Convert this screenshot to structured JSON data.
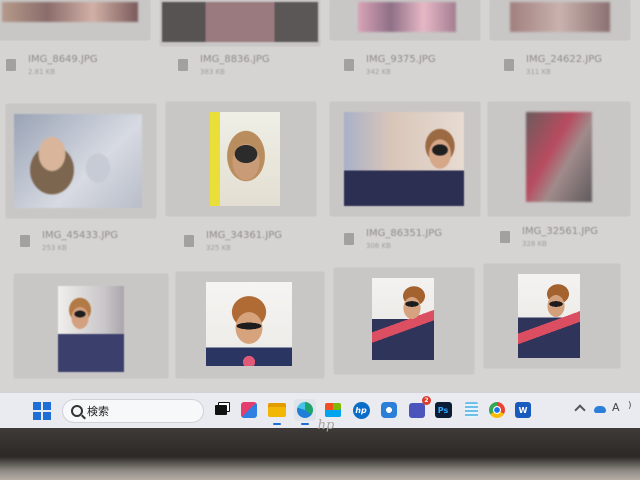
{
  "gallery": {
    "rows": [
      {
        "items": [
          {
            "name": "IMG_8649.JPG",
            "size": "2.81 KB"
          },
          {
            "name": "IMG_8836.JPG",
            "size": "383 KB"
          },
          {
            "name": "IMG_9375.JPG",
            "size": "342 KB"
          },
          {
            "name": "IMG_24622.JPG",
            "size": "311 KB"
          }
        ]
      },
      {
        "items": [
          {
            "name": "IMG_45433.JPG",
            "size": "253 KB"
          },
          {
            "name": "IMG_34361.JPG",
            "size": "325 KB"
          },
          {
            "name": "IMG_86351.JPG",
            "size": "306 KB"
          },
          {
            "name": "IMG_32561.JPG",
            "size": "328 KB"
          }
        ]
      },
      {
        "items": [
          {
            "name": "",
            "size": ""
          },
          {
            "name": "",
            "size": ""
          },
          {
            "name": "",
            "size": ""
          },
          {
            "name": "",
            "size": ""
          }
        ]
      }
    ]
  },
  "taskbar": {
    "search_placeholder": "検索",
    "apps": [
      {
        "icon": "task-view-icon"
      },
      {
        "icon": "widgets-icon"
      },
      {
        "icon": "file-explorer-icon"
      },
      {
        "icon": "edge-browser-icon"
      },
      {
        "icon": "store-icon"
      },
      {
        "icon": "hp-app-icon",
        "label": "hp"
      },
      {
        "icon": "settings-app-icon"
      },
      {
        "icon": "teams-icon",
        "badge": "2"
      },
      {
        "icon": "photoshop-icon",
        "label": "Ps"
      },
      {
        "icon": "notepad-icon"
      },
      {
        "icon": "chrome-icon"
      },
      {
        "icon": "word-icon",
        "label": "W"
      }
    ],
    "tray": {
      "ime_label": "A"
    }
  },
  "bezel": {
    "logo": "hp"
  },
  "colors": {
    "accent": "#1d6fd6",
    "taskbar_bg": "#e9ebf0",
    "gallery_bg": "#d6d4d2"
  }
}
